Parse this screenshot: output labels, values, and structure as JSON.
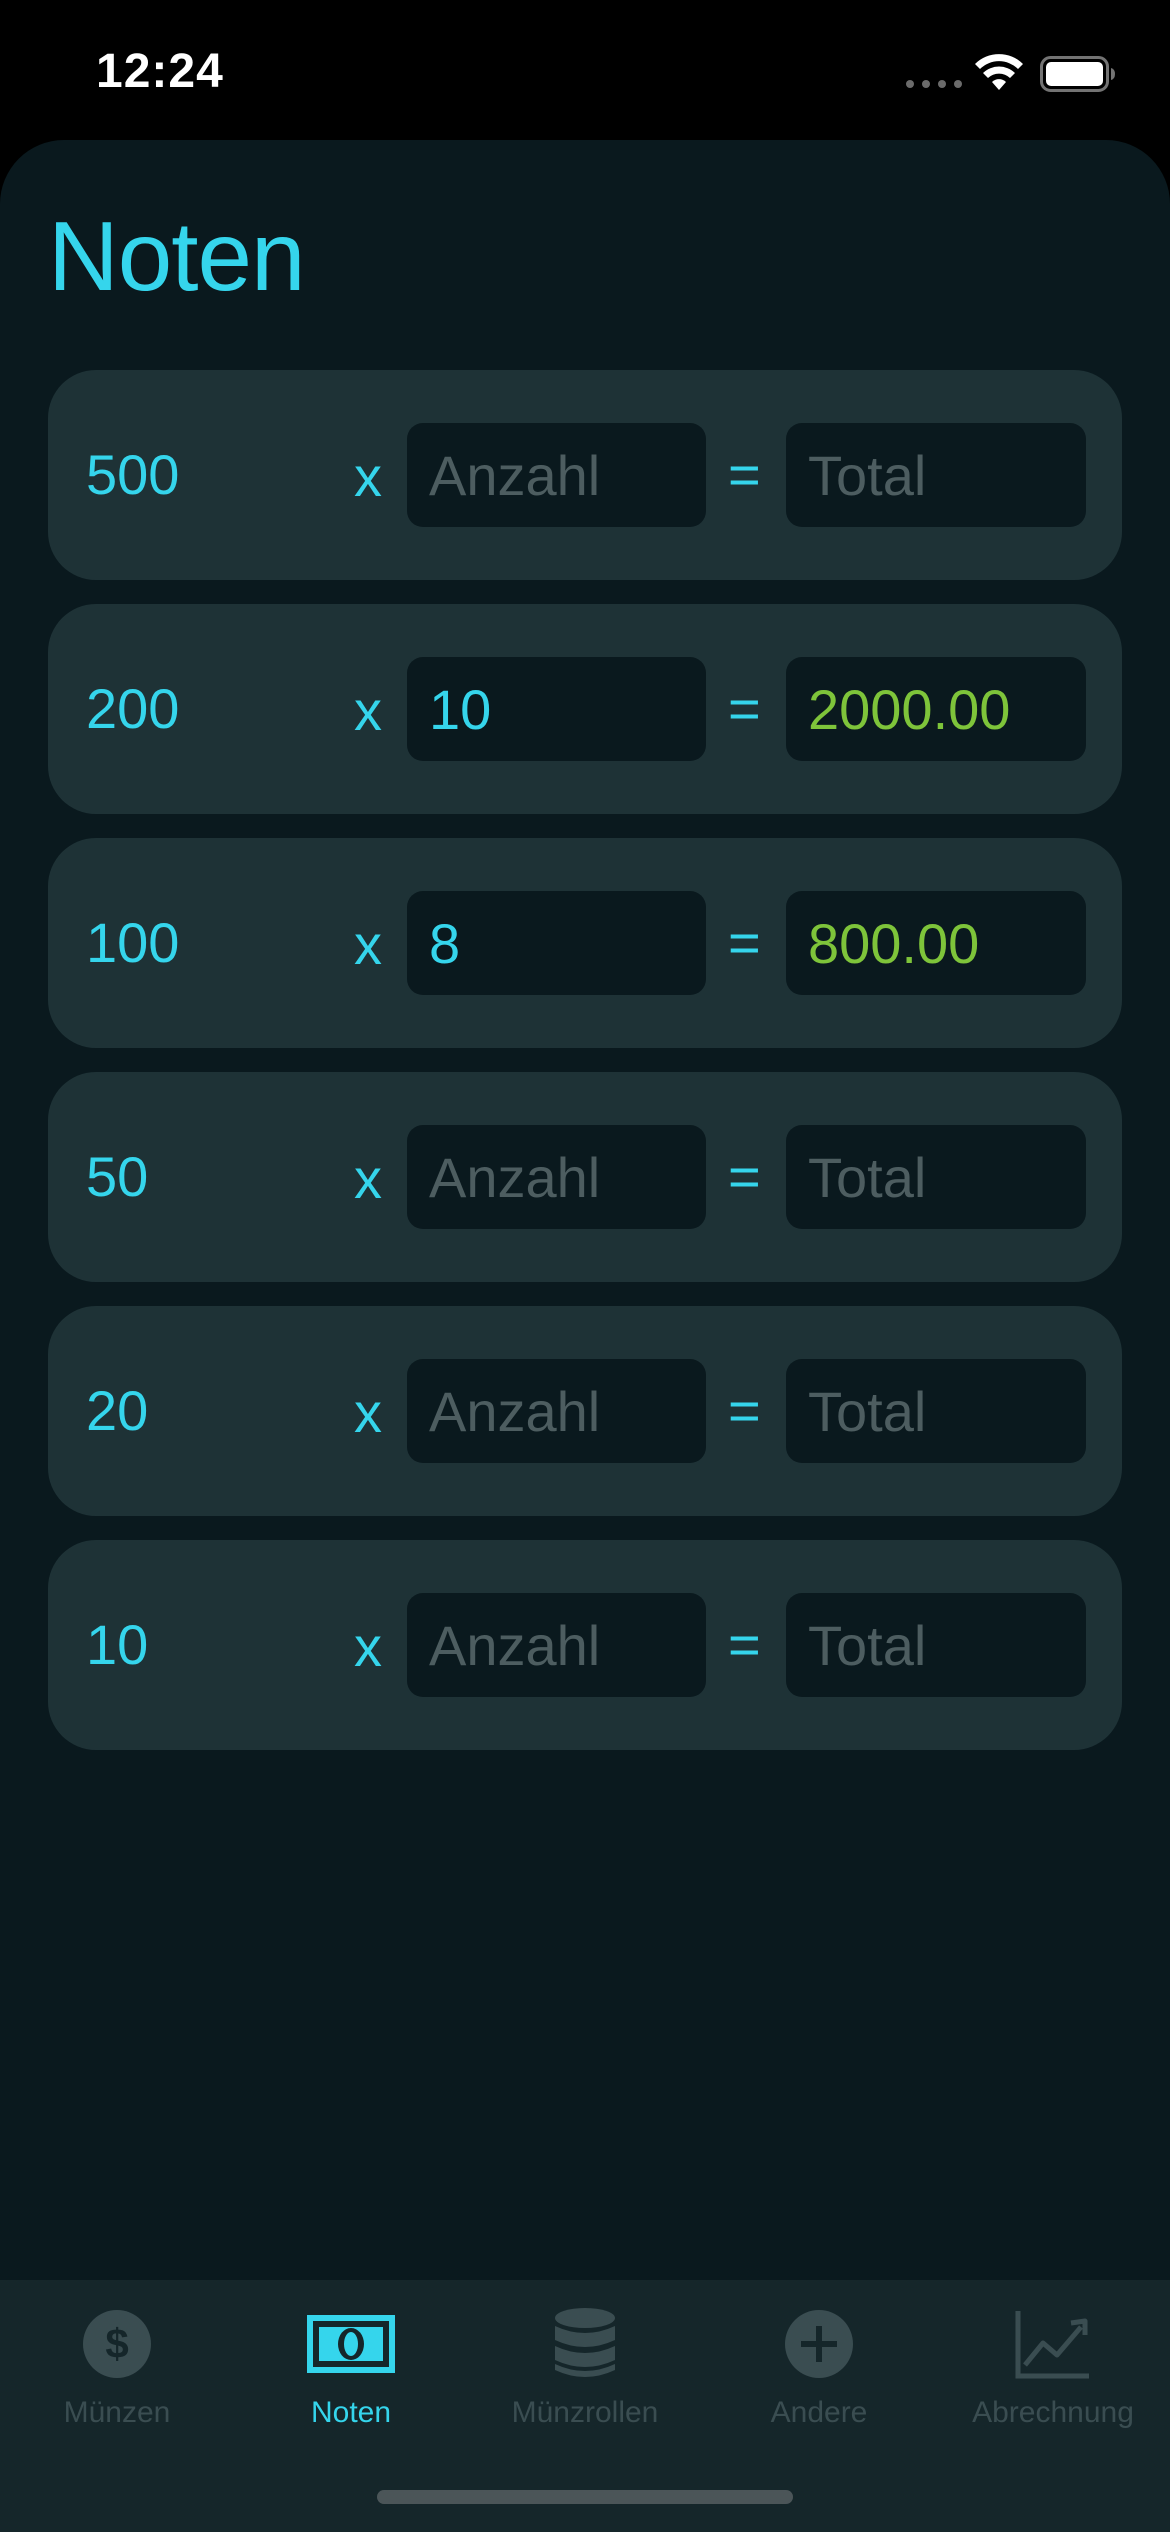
{
  "status_bar": {
    "time": "12:24"
  },
  "page": {
    "title": "Noten"
  },
  "rows": [
    {
      "denomination": "500",
      "multiply": "x",
      "equals": "=",
      "quantity": "",
      "quantity_placeholder": "Anzahl",
      "total": "",
      "total_placeholder": "Total"
    },
    {
      "denomination": "200",
      "multiply": "x",
      "equals": "=",
      "quantity": "10",
      "quantity_placeholder": "Anzahl",
      "total": "2000.00",
      "total_placeholder": "Total"
    },
    {
      "denomination": "100",
      "multiply": "x",
      "equals": "=",
      "quantity": "8",
      "quantity_placeholder": "Anzahl",
      "total": "800.00",
      "total_placeholder": "Total"
    },
    {
      "denomination": "50",
      "multiply": "x",
      "equals": "=",
      "quantity": "",
      "quantity_placeholder": "Anzahl",
      "total": "",
      "total_placeholder": "Total"
    },
    {
      "denomination": "20",
      "multiply": "x",
      "equals": "=",
      "quantity": "",
      "quantity_placeholder": "Anzahl",
      "total": "",
      "total_placeholder": "Total"
    },
    {
      "denomination": "10",
      "multiply": "x",
      "equals": "=",
      "quantity": "",
      "quantity_placeholder": "Anzahl",
      "total": "",
      "total_placeholder": "Total"
    }
  ],
  "tab_bar": {
    "items": [
      {
        "label": "Münzen",
        "icon": "dollar-coin-icon",
        "active": false
      },
      {
        "label": "Noten",
        "icon": "banknote-icon",
        "active": true
      },
      {
        "label": "Münzrollen",
        "icon": "coin-stack-icon",
        "active": false
      },
      {
        "label": "Andere",
        "icon": "plus-circle-icon",
        "active": false
      },
      {
        "label": "Abrechnung",
        "icon": "chart-line-icon",
        "active": false
      }
    ]
  },
  "colors": {
    "accent": "#35d5ec",
    "total_value": "#7ec43a",
    "background": "#0a191e",
    "row_background": "#1e3236",
    "placeholder": "#4d5d60",
    "inactive_tab": "#3a4d51"
  }
}
